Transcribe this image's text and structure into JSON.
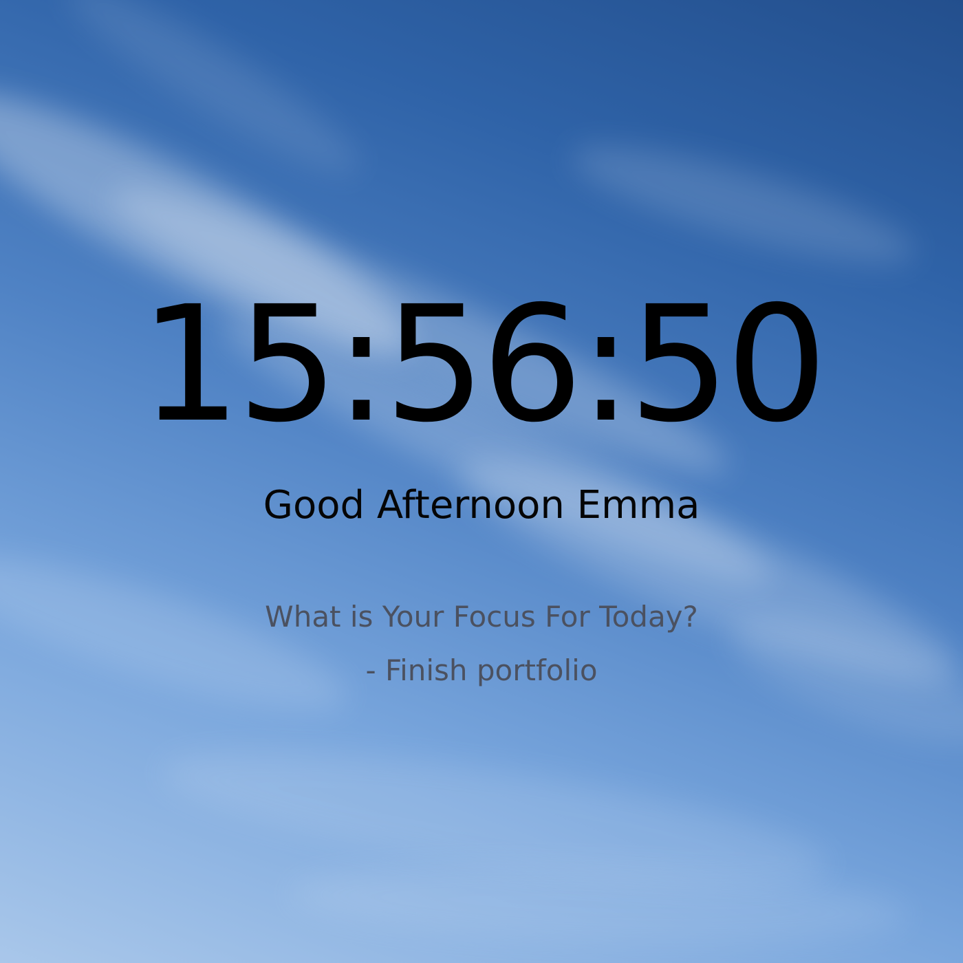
{
  "clock": {
    "time": "15:56:50"
  },
  "greeting": {
    "text": "Good Afternoon Emma"
  },
  "focus": {
    "prompt": "What is Your Focus For Today?",
    "value": "- Finish portfolio"
  },
  "colors": {
    "clock_text": "#000000",
    "greeting_text": "#050505",
    "focus_text": "#4b5160"
  }
}
